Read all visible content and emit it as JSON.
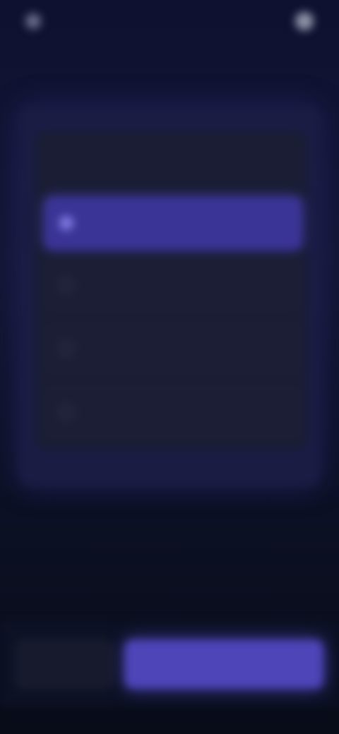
{
  "status_bar": {
    "app_label": "",
    "right_label": ""
  },
  "breadcrumb": "",
  "question": {
    "text": ""
  },
  "options": [
    {
      "label": "",
      "selected": true
    },
    {
      "label": "",
      "selected": false
    },
    {
      "label": "",
      "selected": false
    },
    {
      "label": "",
      "selected": false
    }
  ],
  "footer": {
    "back_label": "",
    "next_label": ""
  },
  "colors": {
    "accent": "#4d45b8",
    "selected_option": "#3a3496",
    "background": "#0b1020"
  }
}
